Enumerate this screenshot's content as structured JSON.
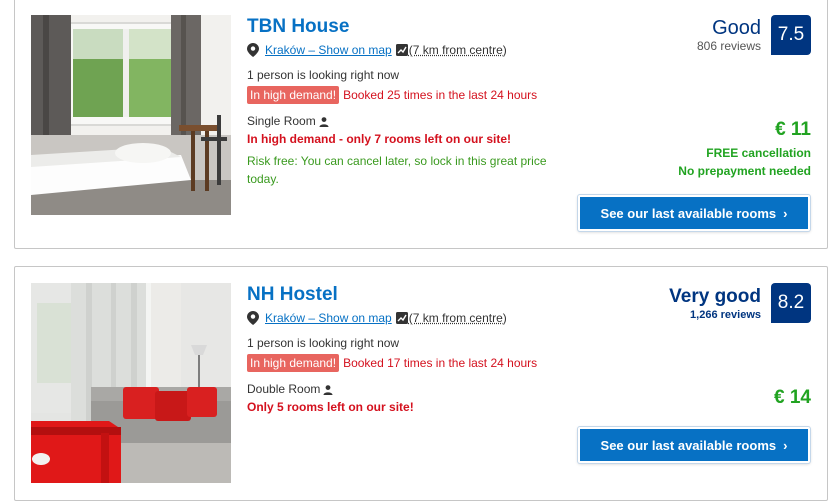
{
  "listings": [
    {
      "name": "TBN House",
      "location_link": "Kraków – Show on map",
      "distance": "(7 km from centre)",
      "looking": "1 person is looking right now",
      "demand_badge": "In high demand!",
      "demand_text": "Booked 25 times in the last 24 hours",
      "room_type": "Single Room",
      "alert": "In high demand - only 7 rooms left on our site!",
      "risk_free": "Risk free: You can cancel later, so lock in this great price today.",
      "score_word": "Good",
      "score": "7.5",
      "reviews": "806 reviews",
      "price": "€ 11",
      "free_cancellation": "FREE cancellation",
      "no_prepayment": "No prepayment needed",
      "cta": "See our last available rooms"
    },
    {
      "name": "NH Hostel",
      "location_link": "Kraków – Show on map",
      "distance": "(7 km from centre)",
      "looking": "1 person is looking right now",
      "demand_badge": "In high demand!",
      "demand_text": "Booked 17 times in the last 24 hours",
      "room_type": "Double Room",
      "alert": "Only 5 rooms left on our site!",
      "score_word": "Very good",
      "score": "8.2",
      "reviews": "1,266 reviews",
      "price": "€ 14",
      "cta": "See our last available rooms"
    }
  ],
  "colors": {
    "link_blue": "#0771c4",
    "score_navy": "#003580",
    "alert_red": "#d4111e",
    "badge_red": "#e8655f",
    "price_green": "#21a321"
  }
}
